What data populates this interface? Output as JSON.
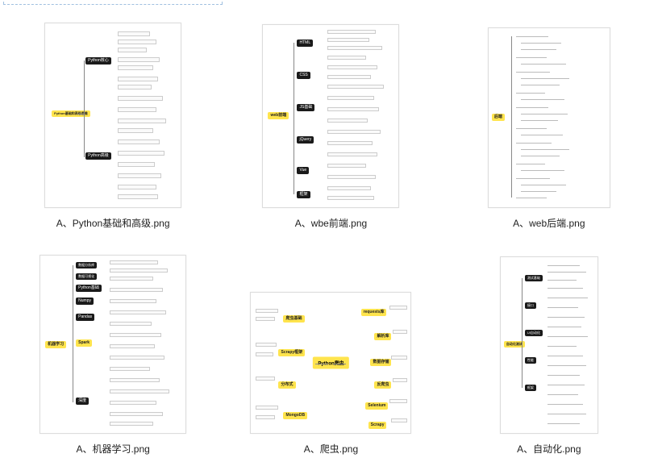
{
  "files": [
    {
      "caption": "A、Python基础和高级.png",
      "root": "Python基础和高级思维"
    },
    {
      "caption": "A、wbe前端.png",
      "root": "web前端"
    },
    {
      "caption": "A、web后端.png",
      "root": "后端"
    },
    {
      "caption": "A、机器学习.png",
      "root": "机器学习"
    },
    {
      "caption": "A、爬虫.png",
      "root": "Python爬虫"
    },
    {
      "caption": "A、自动化.png",
      "root": "自动化测试"
    }
  ],
  "colors": {
    "yellow": "#ffe44d",
    "black": "#1a1a1a"
  }
}
